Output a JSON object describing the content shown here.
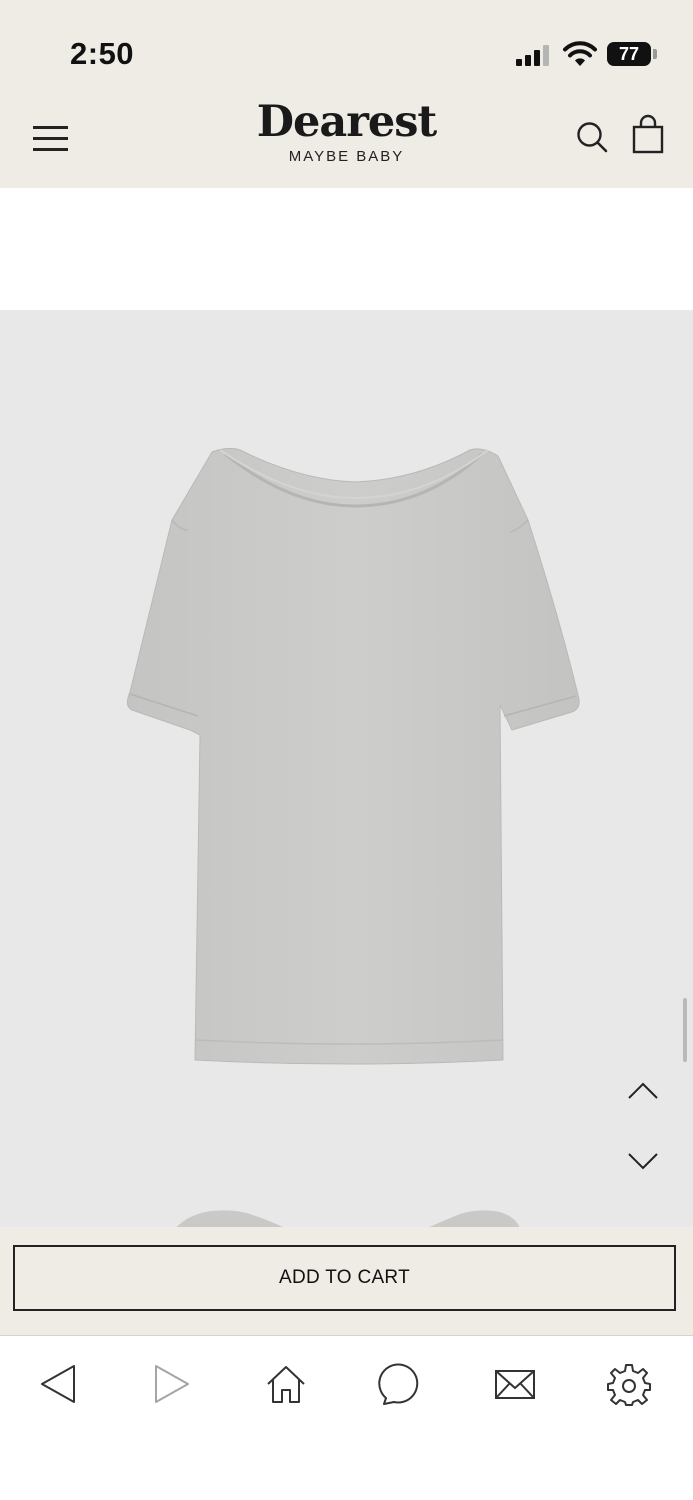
{
  "status_bar": {
    "time": "2:50",
    "battery_level": "77",
    "signal_bars": 3,
    "icons": [
      "cellular-signal-icon",
      "wifi-icon",
      "battery-icon"
    ]
  },
  "header": {
    "brand_name": "Dearest",
    "brand_tagline": "MAYBE BABY",
    "icons": [
      "hamburger-menu-icon",
      "search-icon",
      "shopping-bag-icon"
    ]
  },
  "gallery": {
    "product_image": "grey-tshirt-image",
    "nav_icons": [
      "chevron-up-icon",
      "chevron-down-icon"
    ],
    "background_color": "#e8e8e8",
    "shirt_color": "#c9cac8"
  },
  "cart": {
    "add_to_cart_label": "ADD TO CART"
  },
  "browser_toolbar": {
    "icons": [
      "back-icon",
      "forward-icon",
      "home-icon",
      "chat-icon",
      "mail-icon",
      "settings-icon"
    ]
  },
  "colors": {
    "header_bg": "#efebe5",
    "text": "#111111"
  }
}
